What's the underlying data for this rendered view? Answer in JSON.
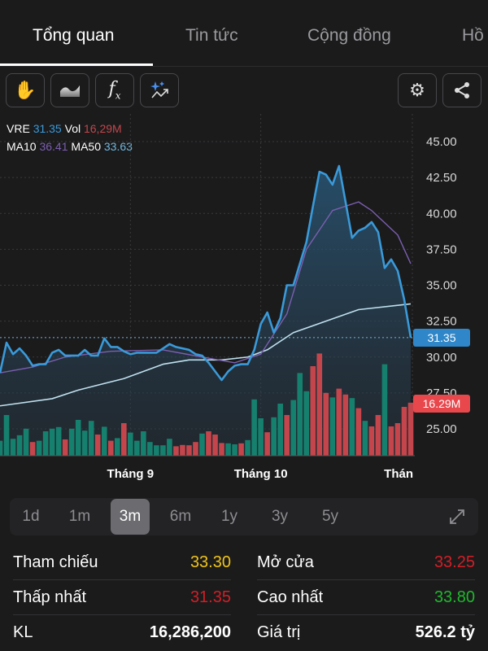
{
  "tabs": [
    {
      "label": "Tổng quan",
      "active": true
    },
    {
      "label": "Tin tức"
    },
    {
      "label": "Cộng đồng"
    },
    {
      "label": "Hồ"
    }
  ],
  "toolbar": {
    "left": [
      "hand-icon",
      "area-chart-icon",
      "function-icon",
      "ai-sparkle-icon"
    ],
    "right": [
      "gear-icon",
      "share-icon"
    ]
  },
  "legend": {
    "symbol": "VRE",
    "price": "31.35",
    "vol_label": "Vol",
    "vol": "16,29M",
    "ma10_label": "MA10",
    "ma10": "36.41",
    "ma50_label": "MA50",
    "ma50": "33.63"
  },
  "colors": {
    "price": "#3a9ad9",
    "ma10": "#7b5fb0",
    "ma50": "#bfe0ee",
    "up": "#16806e",
    "down": "#c4464c",
    "ref": "#f0c419",
    "red": "#d11f26",
    "green": "#1fb82c"
  },
  "chart_data": {
    "type": "line",
    "ylim": [
      23.5,
      46.5
    ],
    "yticks": [
      "45.00",
      "42.50",
      "40.00",
      "37.50",
      "35.00",
      "32.50",
      "30.00",
      "27.50",
      "25.00"
    ],
    "xticks": [
      {
        "label": "Tháng 9",
        "index": 20
      },
      {
        "label": "Tháng 10",
        "index": 40
      },
      {
        "label": "Thán",
        "index": 62
      }
    ],
    "price": [
      28.9,
      31.0,
      30.2,
      30.6,
      30.1,
      29.4,
      29.5,
      29.5,
      30.3,
      30.5,
      30.1,
      30.1,
      30.1,
      30.5,
      30.1,
      30.1,
      31.3,
      30.7,
      30.7,
      30.4,
      30.2,
      30.3,
      30.3,
      30.3,
      30.3,
      30.6,
      30.9,
      30.7,
      30.6,
      30.5,
      30.2,
      30.1,
      29.6,
      29.0,
      28.4,
      29.0,
      29.4,
      29.5,
      29.5,
      30.5,
      32.3,
      33.1,
      31.7,
      32.7,
      35.0,
      35.0,
      36.5,
      38.0,
      40.5,
      42.9,
      42.7,
      42.0,
      43.3,
      40.8,
      38.3,
      38.8,
      39.0,
      39.4,
      38.7,
      36.2,
      36.8,
      36.0,
      34.0,
      31.35
    ],
    "ma10": [
      [
        0,
        28.9
      ],
      [
        5,
        29.3
      ],
      [
        10,
        30.0
      ],
      [
        17,
        30.4
      ],
      [
        25,
        30.5
      ],
      [
        31,
        30.0
      ],
      [
        36,
        29.6
      ],
      [
        40,
        30.2
      ],
      [
        44,
        33.0
      ],
      [
        47,
        37.5
      ],
      [
        51,
        40.2
      ],
      [
        55,
        40.8
      ],
      [
        57,
        40.2
      ],
      [
        61,
        38.5
      ],
      [
        63,
        36.5
      ]
    ],
    "ma50": [
      [
        0,
        26.6
      ],
      [
        8,
        27.1
      ],
      [
        12,
        27.7
      ],
      [
        19,
        28.5
      ],
      [
        25,
        29.5
      ],
      [
        29,
        29.8
      ],
      [
        34,
        29.8
      ],
      [
        38,
        30.0
      ],
      [
        41,
        30.5
      ],
      [
        45,
        31.7
      ],
      [
        50,
        32.5
      ],
      [
        55,
        33.3
      ],
      [
        63,
        33.7
      ]
    ],
    "volume_unit": "M",
    "volume": [
      4.6,
      12.5,
      5.2,
      6.3,
      8.3,
      4.2,
      4.6,
      7.5,
      8.3,
      8.8,
      5.0,
      8.3,
      11.0,
      7.7,
      10.7,
      6.5,
      8.9,
      4.6,
      5.4,
      10.0,
      7.1,
      4.6,
      7.5,
      4.2,
      3.2,
      3.2,
      5.2,
      2.9,
      3.3,
      3.2,
      4.2,
      6.8,
      7.5,
      6.5,
      3.9,
      3.8,
      3.5,
      3.8,
      4.8,
      17.3,
      11.5,
      7.2,
      11.8,
      16.0,
      12.5,
      17.1,
      25.4,
      19.8,
      27.5,
      31.4,
      19.3,
      17.9,
      20.6,
      18.8,
      17.7,
      14.6,
      10.7,
      9.0,
      12.5,
      28.1,
      9.0,
      10.0,
      15.0,
      16.29
    ],
    "volume_dir": "gggggrggggrggggrgrgrgggggggrrrrgrrrggrgggrggrgggrrrgrrgrgrrgrrrr",
    "last_price_label": "31.35",
    "last_volume_label": "16.29M"
  },
  "periods": [
    {
      "label": "1d"
    },
    {
      "label": "1m"
    },
    {
      "label": "3m",
      "active": true
    },
    {
      "label": "6m"
    },
    {
      "label": "1y"
    },
    {
      "label": "3y"
    },
    {
      "label": "5y"
    }
  ],
  "stats": [
    {
      "label": "Tham chiếu",
      "value": "33.30",
      "color": "#f0c419"
    },
    {
      "label": "Mở cửa",
      "value": "33.25",
      "color": "#d11f26"
    },
    {
      "label": "Thấp nhất",
      "value": "31.35",
      "color": "#d11f26"
    },
    {
      "label": "Cao nhất",
      "value": "33.80",
      "color": "#1fb82c"
    },
    {
      "label": "KL",
      "value": "16,286,200",
      "color": "#ffffff"
    },
    {
      "label": "Giá trị",
      "value": "526.2 tỷ",
      "color": "#ffffff"
    }
  ]
}
